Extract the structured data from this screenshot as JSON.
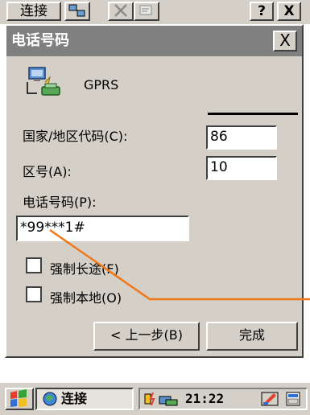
{
  "toolbar": {
    "connect_label": "连接",
    "help_label": "?",
    "close_label": "X"
  },
  "dialog": {
    "title": "电话号码",
    "close_label": "X",
    "connection_name": "GPRS",
    "country_label": "国家/地区代码(C):",
    "country_value": "86",
    "area_label": "区号(A):",
    "area_value": "10",
    "phone_label": "电话号码(P):",
    "phone_value": "*99***1#",
    "force_long_label": "强制长途(F)",
    "force_local_label": "强制本地(O)",
    "back_label": "< 上一步(B)",
    "finish_label": "完成"
  },
  "taskbar": {
    "task_label": "连接",
    "clock": "21:22"
  },
  "colors": {
    "face": "#d4d0c8",
    "titlebar": "#808080",
    "annotation": "#f07818"
  }
}
